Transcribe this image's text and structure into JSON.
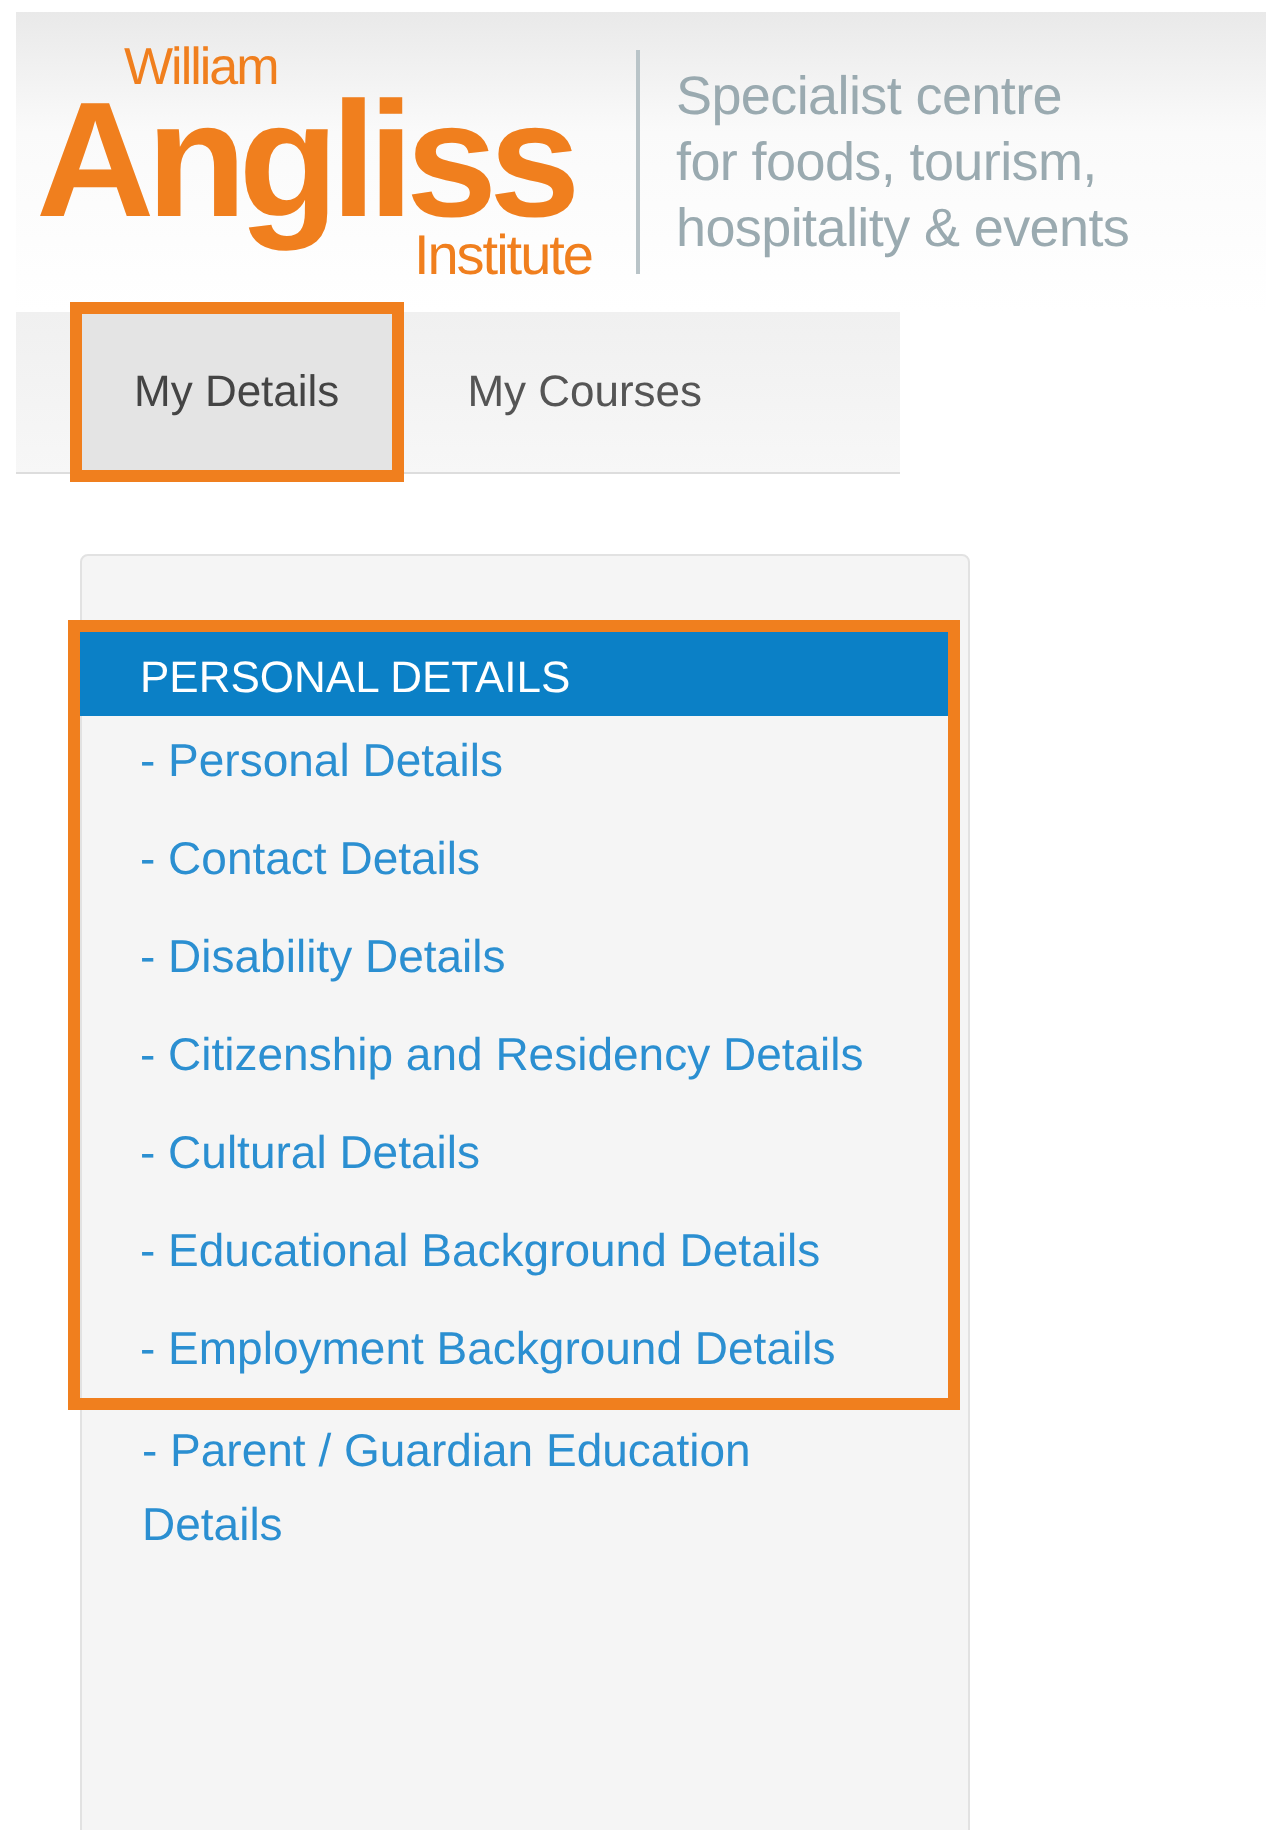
{
  "logo": {
    "top": "William",
    "main": "Angliss",
    "bottom": "Institute"
  },
  "tagline": [
    "Specialist centre",
    "for foods, tourism,",
    "hospitality & events"
  ],
  "tabs": [
    {
      "label": "My Details",
      "selected": true,
      "highlighted": true
    },
    {
      "label": "My Courses",
      "selected": false,
      "highlighted": false
    }
  ],
  "menu": {
    "heading": "PERSONAL DETAILS",
    "highlighted": true,
    "framed_items": [
      "- Personal Details",
      "- Contact Details",
      "- Disability Details",
      "- Citizenship and Residency Details",
      "- Cultural Details",
      "- Educational Background Details",
      "- Employment Background Details"
    ],
    "items": [
      "- Parent / Guardian Education Details"
    ]
  }
}
